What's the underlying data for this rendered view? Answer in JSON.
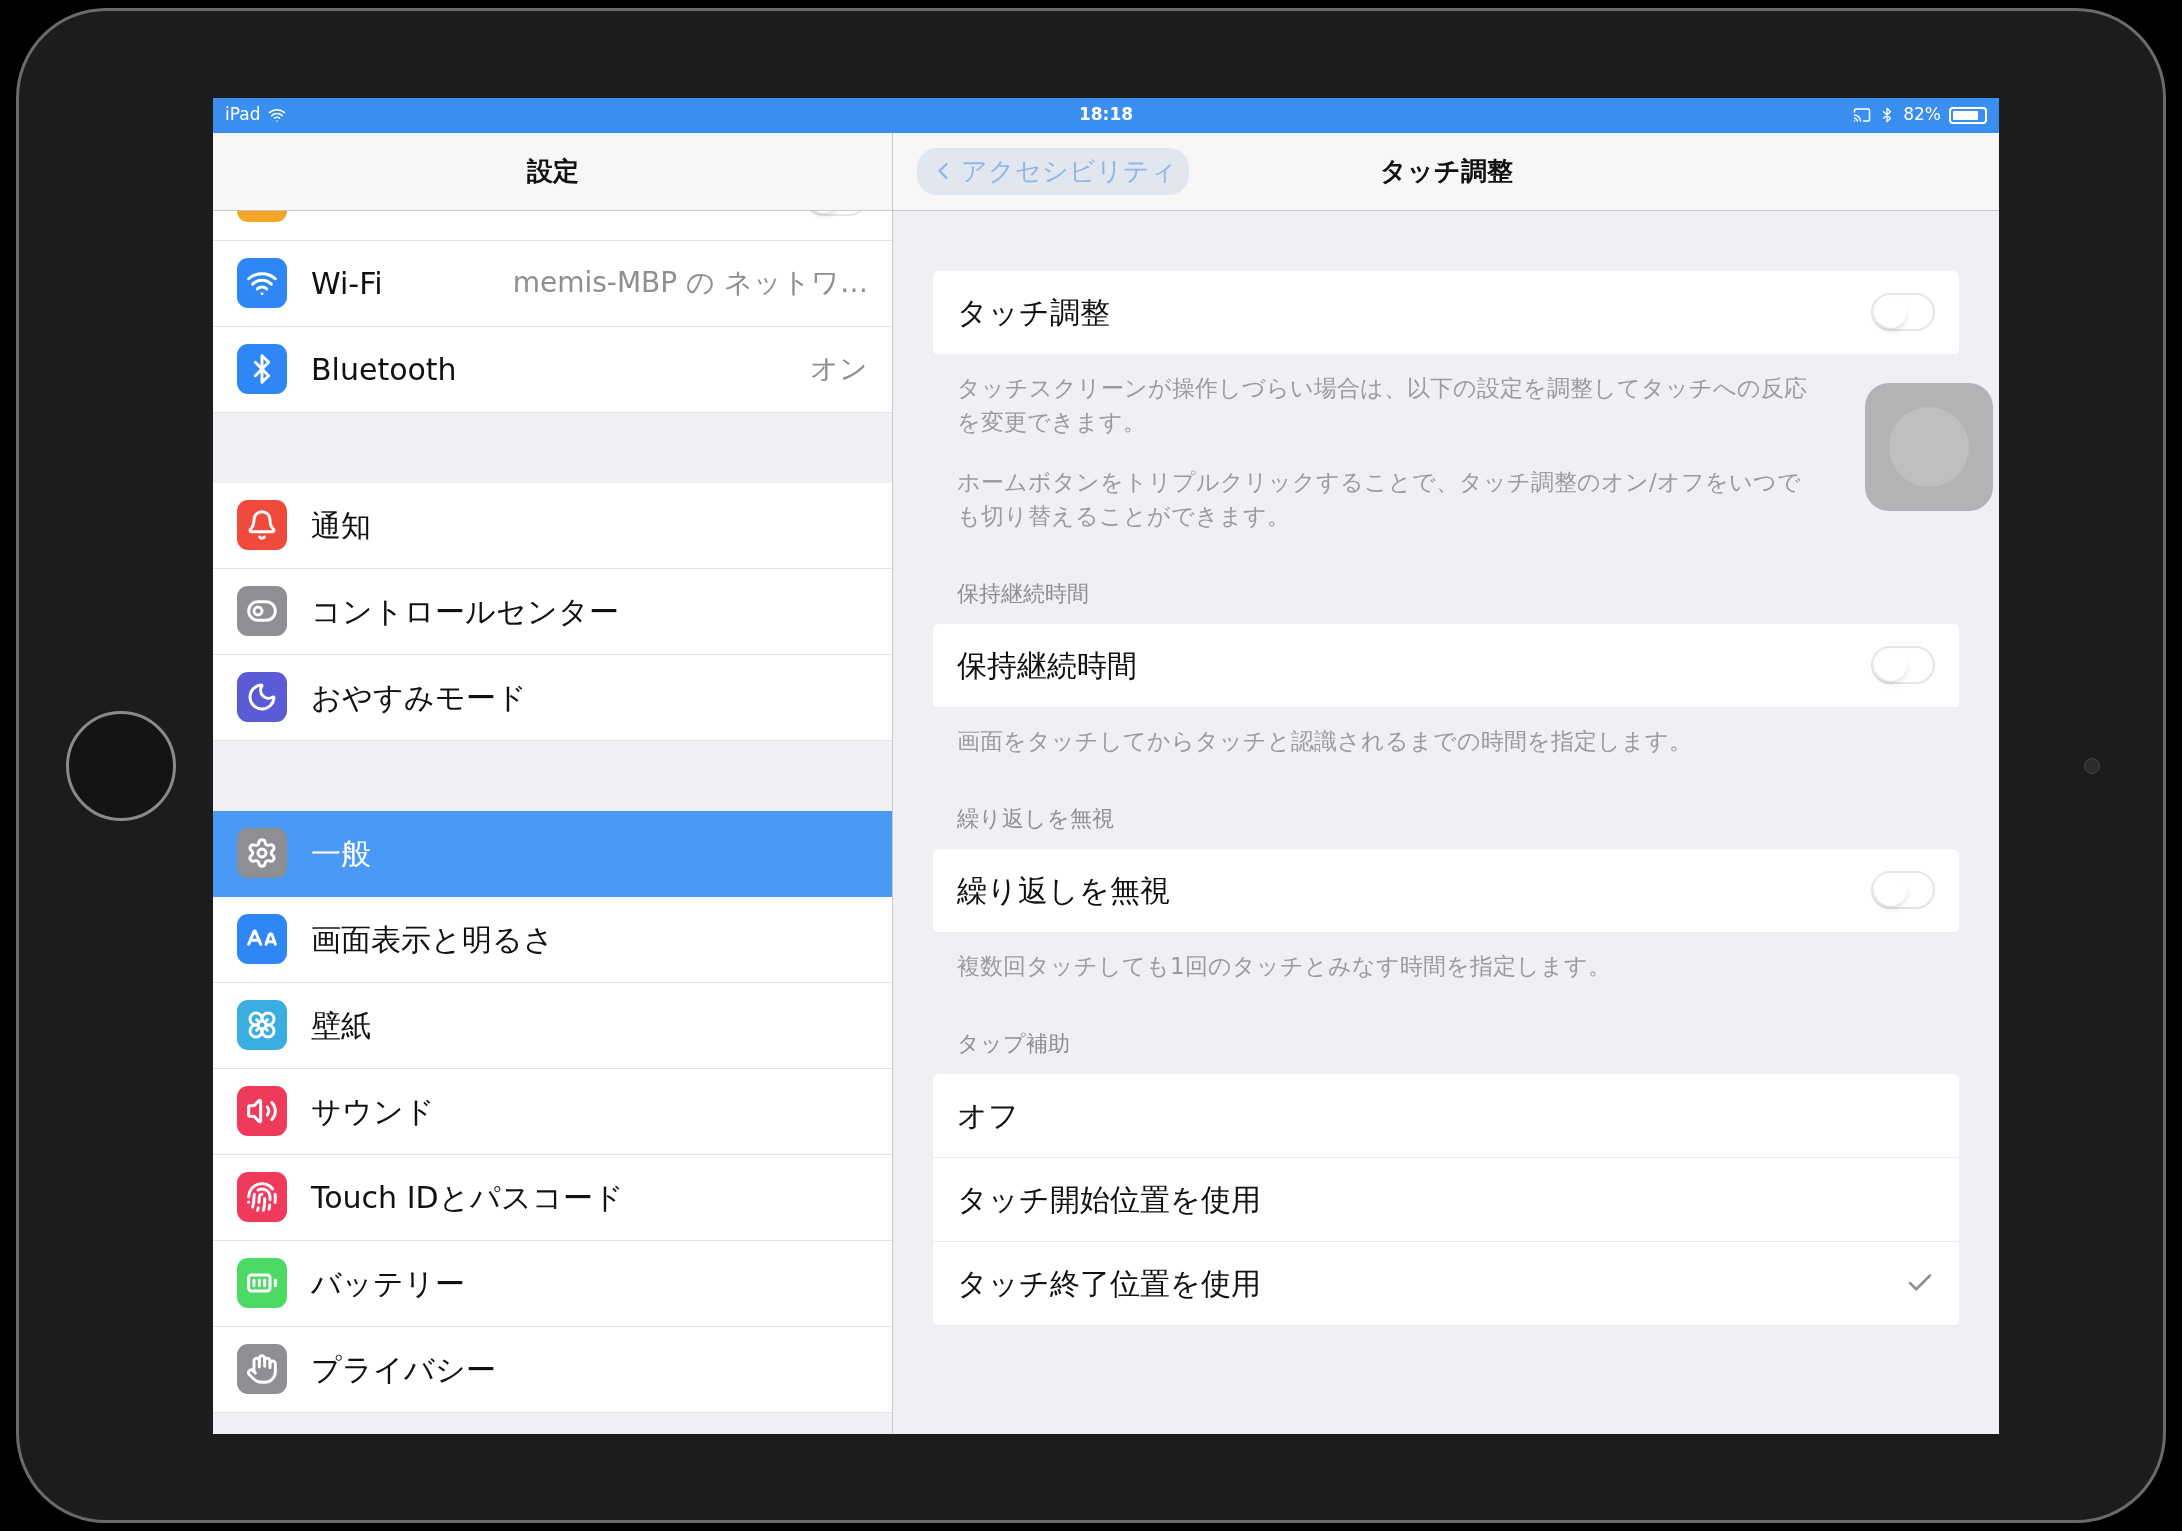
{
  "status_bar": {
    "device": "iPad",
    "time": "18:18",
    "battery_text": "82%"
  },
  "nav": {
    "master_title": "設定",
    "back": "アクセシビリティ",
    "title": "タッチ調整"
  },
  "sidebar": {
    "groups": [
      [
        {
          "kind": "airplane",
          "color": "#f5a623",
          "selected": false,
          "toggle": {
            "on": false
          }
        },
        {
          "kind": "wifi",
          "label": "Wi-Fi",
          "value": "memis-MBP の ネットワ…",
          "color": "#2f86f6",
          "selected": false
        },
        {
          "kind": "bluetooth",
          "label": "Bluetooth",
          "value": "オン",
          "color": "#2f86f6",
          "selected": false
        }
      ],
      [
        {
          "kind": "notifications",
          "label": "通知",
          "color": "#f04a3c",
          "selected": false
        },
        {
          "kind": "control",
          "label": "コントロールセンター",
          "color": "#8e8e93",
          "selected": false
        },
        {
          "kind": "moon",
          "label": "おやすみモード",
          "color": "#5b5bd6",
          "selected": false
        }
      ],
      [
        {
          "kind": "gear",
          "label": "一般",
          "color": "#8e8e93",
          "selected": true
        },
        {
          "kind": "display",
          "label": "画面表示と明るさ",
          "color": "#2f86f6",
          "selected": false
        },
        {
          "kind": "wallpaper",
          "label": "壁紙",
          "color": "#3aaee0",
          "selected": false
        },
        {
          "kind": "sound",
          "label": "サウンド",
          "color": "#f03a5c",
          "selected": false
        },
        {
          "kind": "touchid",
          "label": "Touch IDとパスコード",
          "color": "#f03a5c",
          "selected": false
        },
        {
          "kind": "battery",
          "label": "バッテリー",
          "color": "#4cd964",
          "selected": false
        },
        {
          "kind": "privacy",
          "label": "プライバシー",
          "color": "#8e8e93",
          "selected": false
        }
      ]
    ]
  },
  "detail": {
    "sections": [
      {
        "rows": [
          {
            "kind": "toggle",
            "label": "タッチ調整",
            "on": false
          }
        ],
        "footer": [
          "タッチスクリーンが操作しづらい場合は、以下の設定を調整してタッチへの反応を変更できます。",
          "ホームボタンをトリプルクリックすることで、タッチ調整のオン/オフをいつでも切り替えることができます。"
        ]
      },
      {
        "header": "保持継続時間",
        "rows": [
          {
            "kind": "toggle",
            "label": "保持継続時間",
            "on": false
          }
        ],
        "footer": [
          "画面をタッチしてからタッチと認識されるまでの時間を指定します。"
        ]
      },
      {
        "header": "繰り返しを無視",
        "rows": [
          {
            "kind": "toggle",
            "label": "繰り返しを無視",
            "on": false
          }
        ],
        "footer": [
          "複数回タッチしても1回のタッチとみなす時間を指定します。"
        ]
      },
      {
        "header": "タップ補助",
        "rows": [
          {
            "kind": "option",
            "label": "オフ",
            "checked": false
          },
          {
            "kind": "option",
            "label": "タッチ開始位置を使用",
            "checked": false
          },
          {
            "kind": "option",
            "label": "タッチ終了位置を使用",
            "checked": true
          }
        ]
      }
    ]
  }
}
